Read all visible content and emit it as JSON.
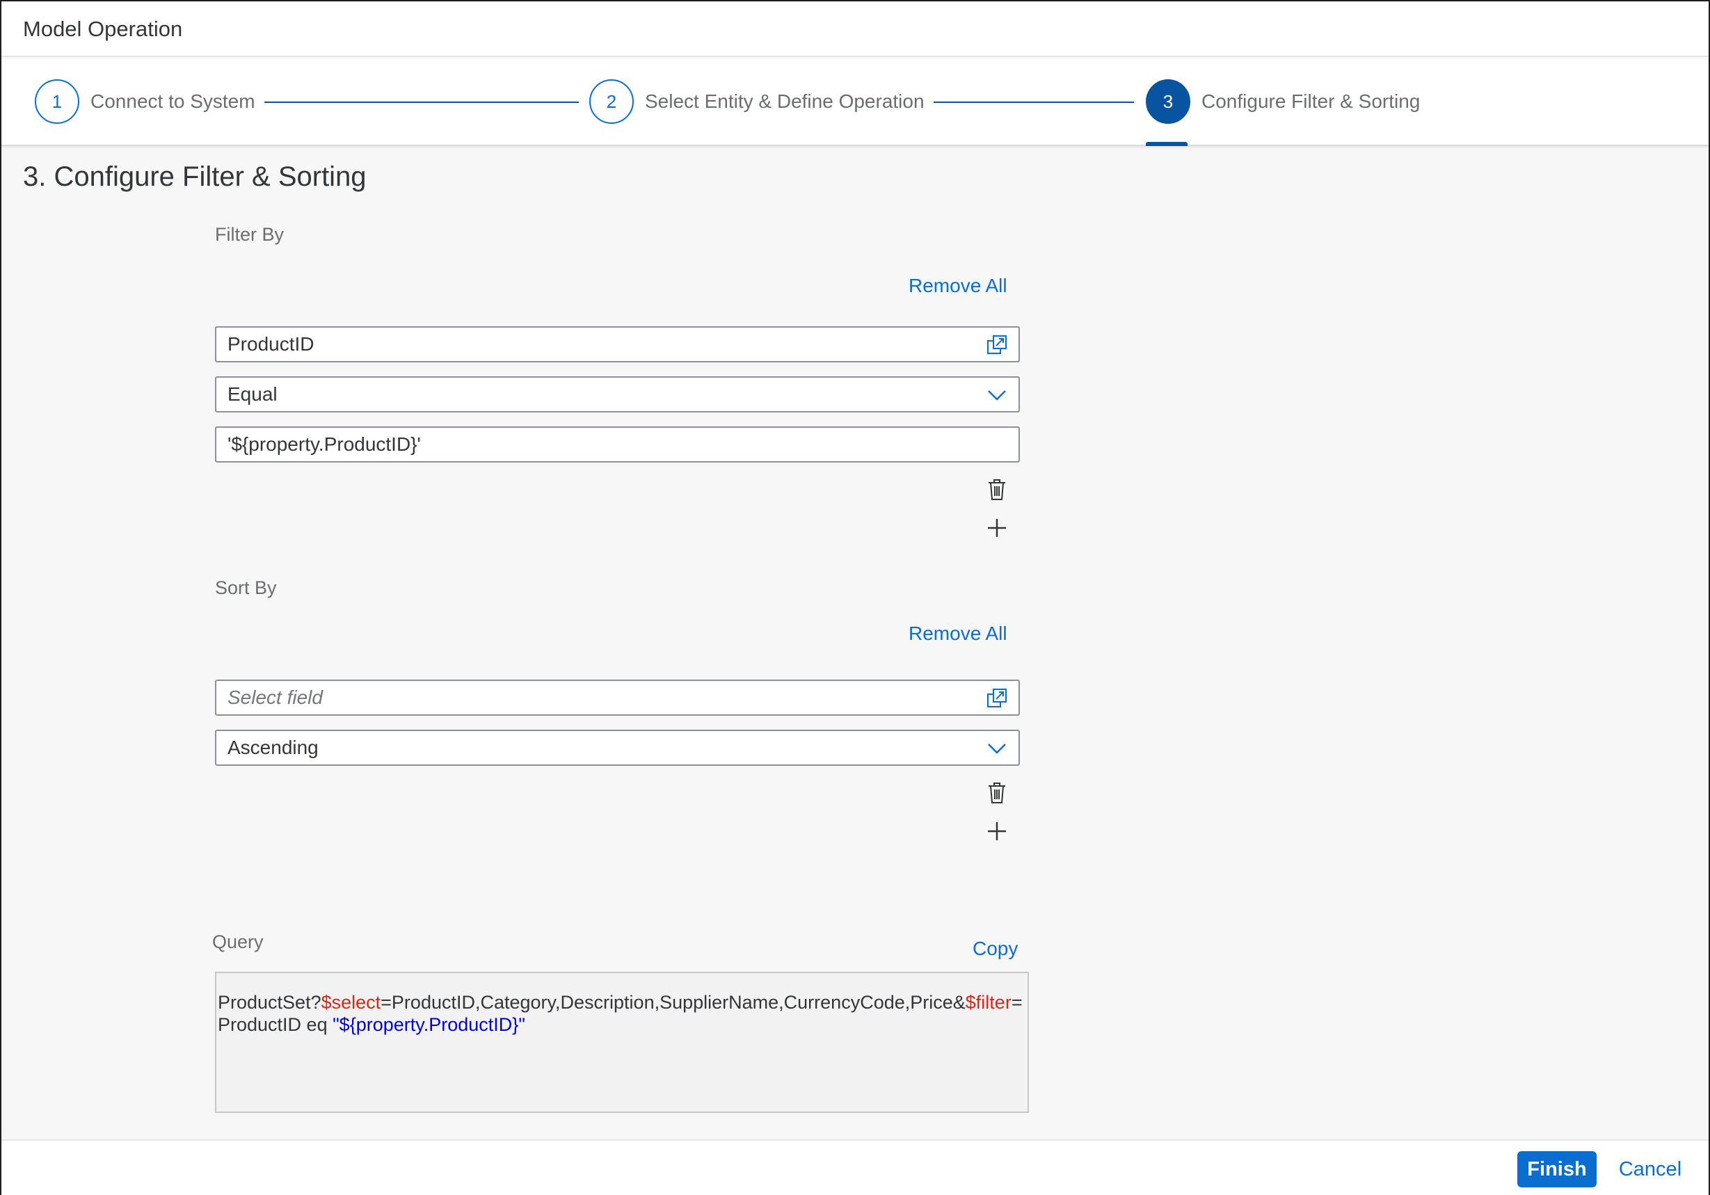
{
  "dialog": {
    "title": "Model Operation"
  },
  "wizard": {
    "steps": [
      {
        "number": "1",
        "label": "Connect to System"
      },
      {
        "number": "2",
        "label": "Select Entity & Define Operation"
      },
      {
        "number": "3",
        "label": "Configure Filter & Sorting",
        "active": true
      }
    ]
  },
  "content": {
    "section_title": "3. Configure Filter & Sorting",
    "filter": {
      "label": "Filter By",
      "remove_all": "Remove All",
      "field_value": "ProductID",
      "operator_value": "Equal",
      "value_text": "'${property.ProductID}'"
    },
    "sort": {
      "label": "Sort By",
      "remove_all": "Remove All",
      "field_placeholder": "Select field",
      "order_value": "Ascending"
    },
    "query": {
      "label": "Query",
      "copy": "Copy",
      "part1": "ProductSet?",
      "select_kw": "$select",
      "part2": "=ProductID,Category,Description,SupplierName,CurrencyCode,Price&",
      "filter_kw": "$filter",
      "part3": "=ProductID eq ",
      "str_value": "\"${property.ProductID}\""
    }
  },
  "footer": {
    "finish": "Finish",
    "cancel": "Cancel"
  },
  "icons": {
    "value_help": "value-help-icon",
    "dropdown": "chevron-down-icon",
    "delete": "trash-icon",
    "add": "plus-icon"
  },
  "colors": {
    "accent": "#0a6ed1",
    "active_step": "#0854a0",
    "query_keyword": "#d0291b",
    "query_string": "#0000d6"
  }
}
